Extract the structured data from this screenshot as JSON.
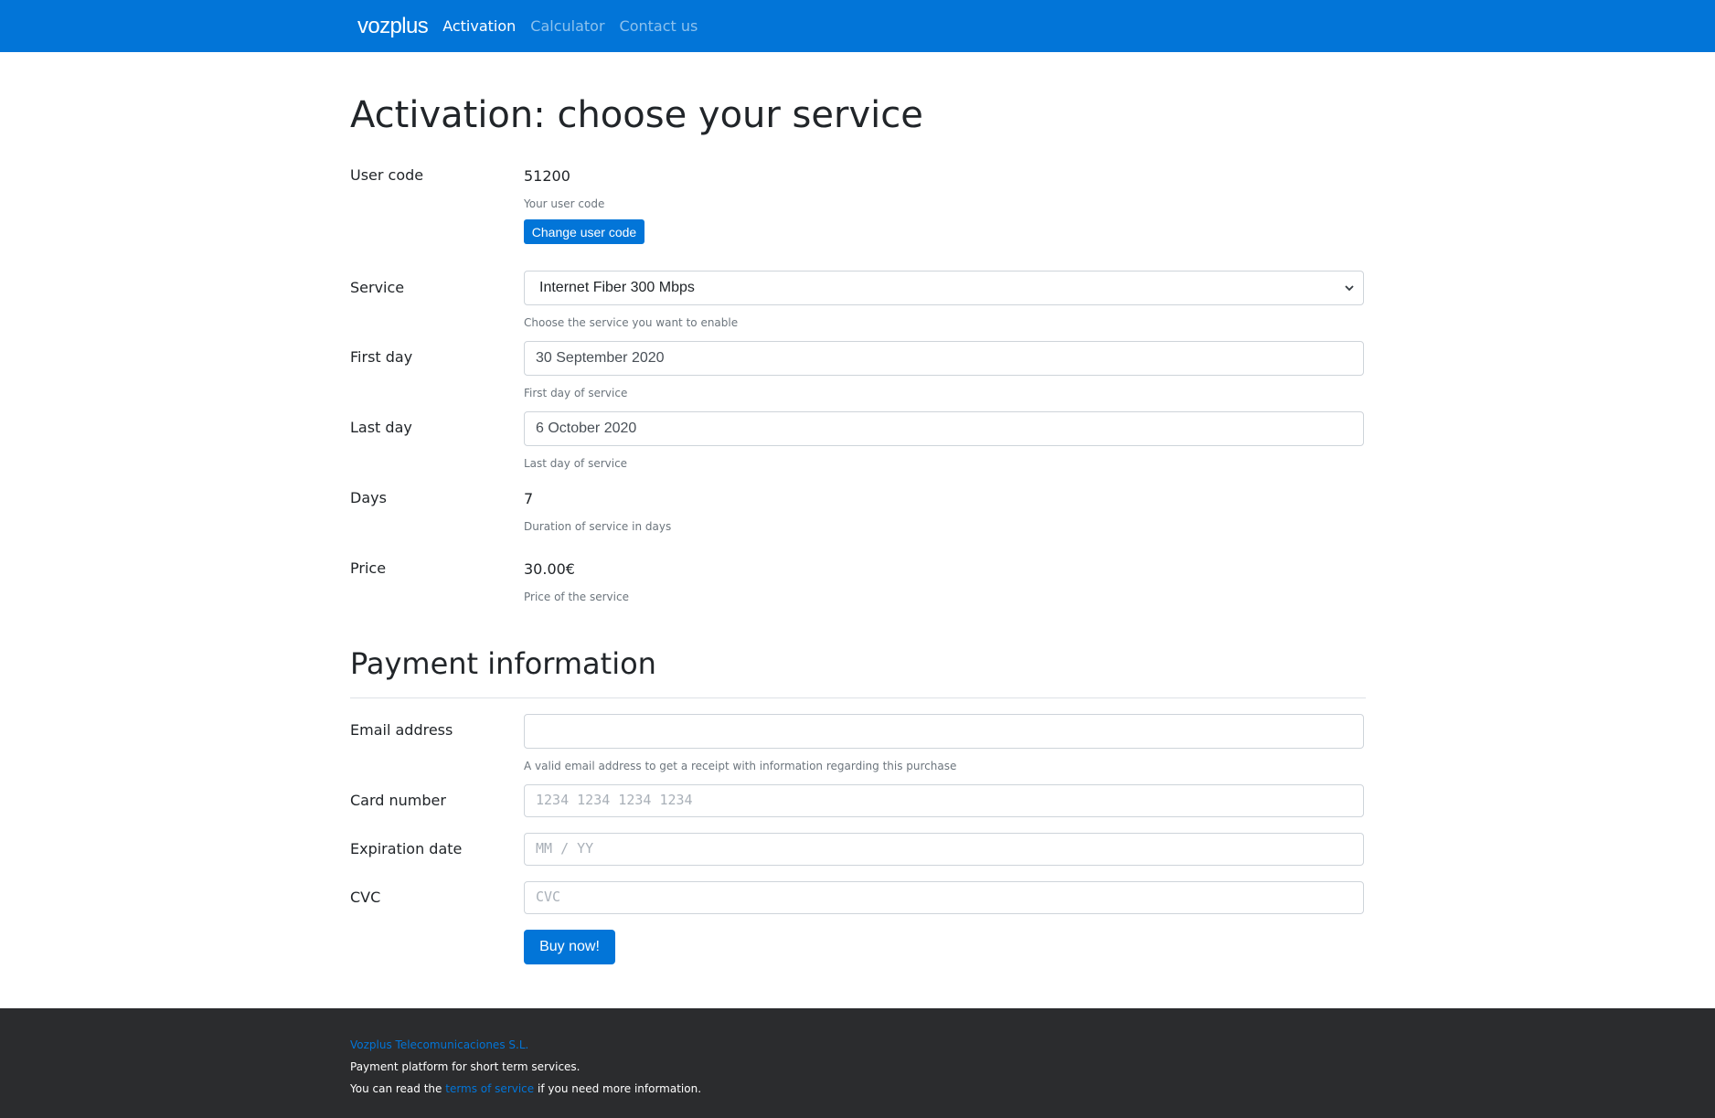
{
  "navbar": {
    "brand": "vozplus",
    "links": [
      {
        "label": "Activation",
        "active": true
      },
      {
        "label": "Calculator",
        "active": false
      },
      {
        "label": "Contact us",
        "active": false
      }
    ]
  },
  "page": {
    "title": "Activation: choose your service"
  },
  "user_code": {
    "label": "User code",
    "value": "51200",
    "help": "Your user code",
    "button": "Change user code"
  },
  "service": {
    "label": "Service",
    "selected": "Internet Fiber 300 Mbps",
    "help": "Choose the service you want to enable"
  },
  "first_day": {
    "label": "First day",
    "value": "30 September 2020",
    "help": "First day of service"
  },
  "last_day": {
    "label": "Last day",
    "value": "6 October 2020",
    "help": "Last day of service"
  },
  "days": {
    "label": "Days",
    "value": "7",
    "help": "Duration of service in days"
  },
  "price": {
    "label": "Price",
    "value": "30.00€",
    "help": "Price of the service"
  },
  "payment": {
    "title": "Payment information",
    "email": {
      "label": "Email address",
      "value": "",
      "placeholder": "",
      "help": "A valid email address to get a receipt with information regarding this purchase"
    },
    "card_number": {
      "label": "Card number",
      "placeholder": "1234 1234 1234 1234"
    },
    "expiration": {
      "label": "Expiration date",
      "placeholder": "MM / YY"
    },
    "cvc": {
      "label": "CVC",
      "placeholder": "CVC"
    },
    "buy_button": "Buy now!"
  },
  "footer": {
    "company": "Vozplus Telecomunicaciones S.L.",
    "tagline": "Payment platform for short term services.",
    "tos_prefix": "You can read the",
    "tos_link": "terms of service",
    "tos_suffix": "if you need more information."
  },
  "colors": {
    "primary": "#0275d8",
    "footer_bg": "#2b2c2e",
    "muted_text": "#6c757d"
  }
}
